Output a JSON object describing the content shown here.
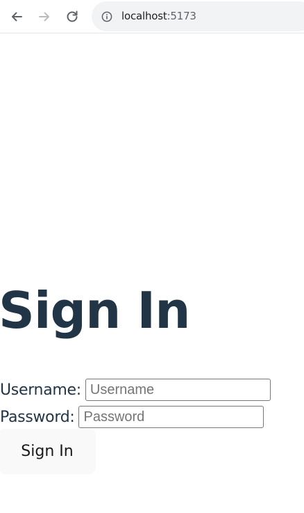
{
  "browser": {
    "url_host": "localhost",
    "url_port": ":5173",
    "icons": {
      "back": "back-arrow-icon",
      "forward": "forward-arrow-icon",
      "reload": "reload-icon",
      "site_info": "info-icon"
    }
  },
  "page": {
    "title": "Sign In",
    "colors": {
      "text": "#213547",
      "button_bg": "#f9f9f9"
    }
  },
  "form": {
    "username_label": "Username:",
    "username_placeholder": "Username",
    "username_value": "",
    "password_label": "Password:",
    "password_placeholder": "Password",
    "password_value": "",
    "submit_label": "Sign In"
  }
}
